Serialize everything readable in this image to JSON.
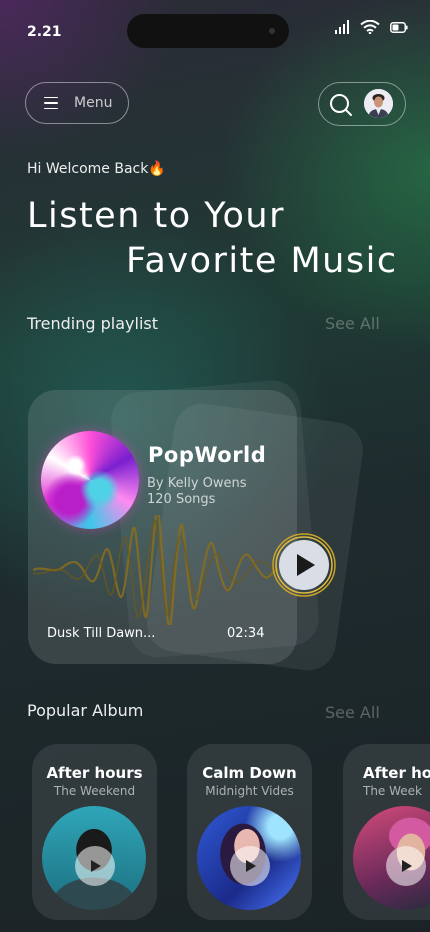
{
  "status_bar": {
    "time": "2.21"
  },
  "header": {
    "menu_label": "Menu"
  },
  "greeting": "Hi Welcome Back🔥",
  "headline": {
    "line1": "Listen to Your",
    "line2": "Favorite Music"
  },
  "trending": {
    "section_title": "Trending  playlist",
    "see_all": "See All",
    "playlist": {
      "title": "PopWorld",
      "author": "By Kelly Owens",
      "count": "120 Songs",
      "now_playing": "Dusk Till Dawn...",
      "duration": "02:34"
    }
  },
  "popular": {
    "section_title": "Popular Album",
    "see_all": "See All",
    "albums": [
      {
        "title": "After hours",
        "artist": "The Weekend"
      },
      {
        "title": "Calm Down",
        "artist": "Midnight Vides"
      },
      {
        "title": "After ho",
        "artist": "The Week"
      }
    ]
  },
  "colors": {
    "accent_gold": "#c9a227",
    "pink": "#ff4fd8"
  }
}
